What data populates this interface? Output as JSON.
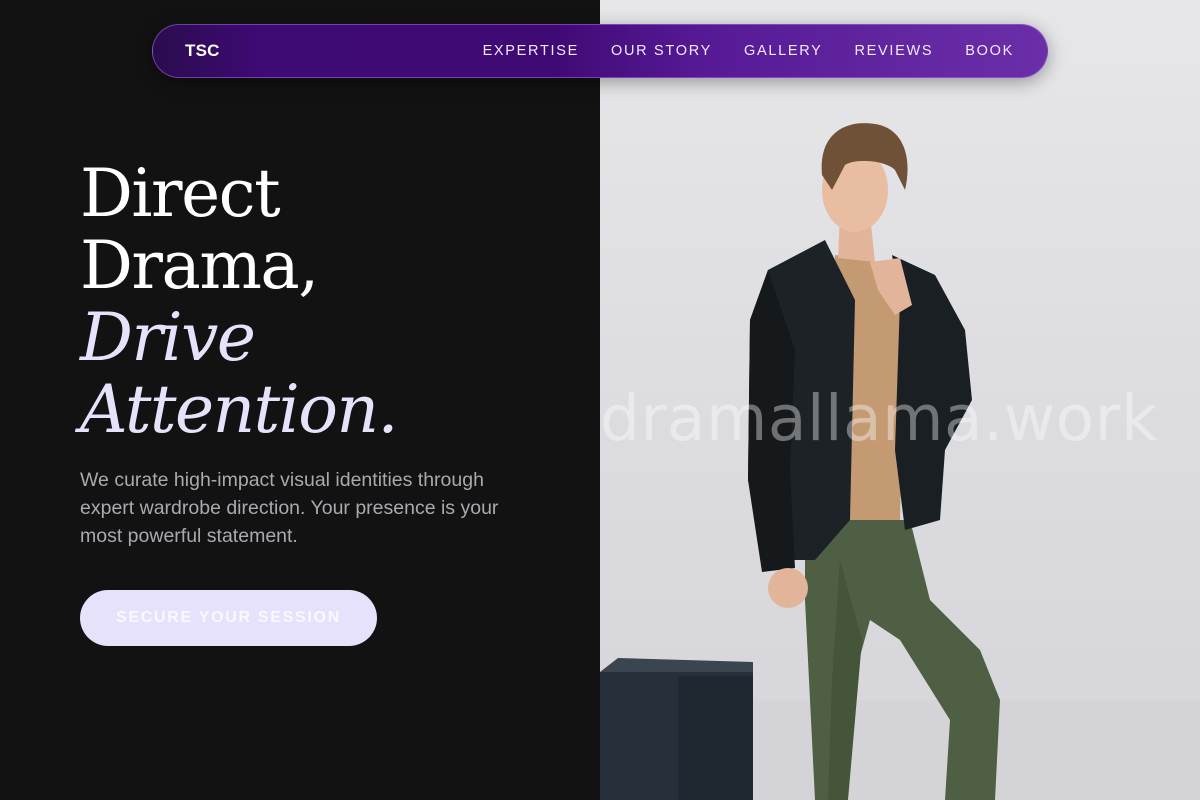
{
  "nav": {
    "brand": "TSC",
    "links": [
      "EXPERTISE",
      "OUR STORY",
      "GALLERY",
      "REVIEWS",
      "BOOK"
    ]
  },
  "hero": {
    "headline_line1": "Direct",
    "headline_line2": "Drama,",
    "headline_line3": "Drive",
    "headline_line4": "Attention.",
    "subcopy": "We curate high-impact visual identities through expert wardrobe direction. Your presence is your most powerful statement.",
    "cta_label": "SECURE YOUR SESSION"
  },
  "photo": {
    "watermark": "dramallama.work"
  },
  "colors": {
    "background": "#121212",
    "nav_purple": "#400a75",
    "accent_lavender": "#e6e2fb",
    "body_text": "#a9a9b1"
  }
}
